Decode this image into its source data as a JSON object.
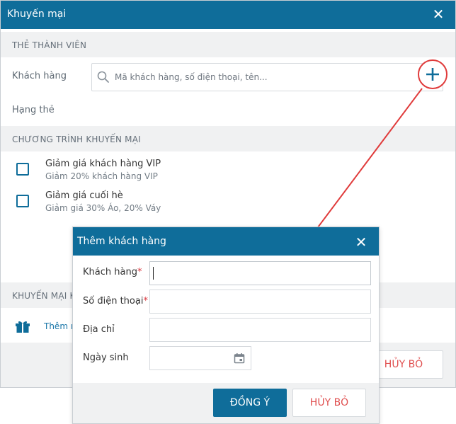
{
  "main_dialog": {
    "title": "Khuyến mại",
    "close_glyph": "✕",
    "member_section": "THẺ THÀNH VIÊN",
    "customer_label": "Khách hàng",
    "search_placeholder": "Mã khách hàng, số điện thoại, tên...",
    "card_rank_label": "Hạng thẻ",
    "promo_section": "CHƯƠNG TRÌNH KHUYẾN MẠI",
    "promotions": [
      {
        "name": "Giảm giá khách hàng VIP",
        "desc": "Giảm 20% khách hàng VIP",
        "checked": false
      },
      {
        "name": "Giảm giá cuối hè",
        "desc": "Giảm giá 30% Áo, 20% Váy",
        "checked": false
      }
    ],
    "promo2_section": "KHUYẾN MẠI K",
    "add_link": "Thêm m",
    "cancel_label": "HỦY BỎ"
  },
  "add_customer_dialog": {
    "title": "Thêm khách hàng",
    "close_glyph": "✕",
    "fields": {
      "customer": {
        "label": "Khách hàng",
        "required_mark": "*",
        "value": ""
      },
      "phone": {
        "label": "Số điện thoại",
        "required_mark": "*",
        "value": ""
      },
      "address": {
        "label": "Địa chỉ",
        "value": ""
      },
      "birthday": {
        "label": "Ngày sinh",
        "value": ""
      }
    },
    "ok_label": "ĐỒNG Ý",
    "cancel_label": "HỦY BỎ"
  },
  "icons": {
    "search": "search-icon",
    "add": "plus-icon",
    "gift": "gift-icon",
    "calendar": "calendar-icon"
  },
  "colors": {
    "header": "#0f6d9a",
    "annotation": "#e03b3b",
    "cancel_text": "#e05050"
  }
}
